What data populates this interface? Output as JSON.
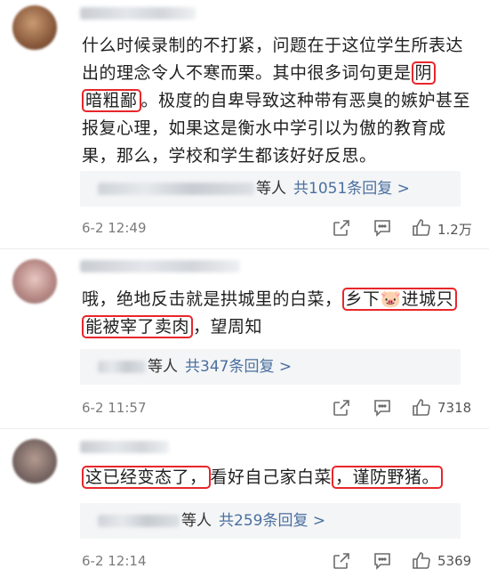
{
  "comments": [
    {
      "text_before": "什么时候录制的不打紧，问题在于这位学生所表达出的理念令人不寒而栗。其中很多词句更是",
      "hl1": "阴",
      "hl2": "暗粗鄙",
      "text_after": "。极度的自卑导致这种带有恶臭的嫉妒甚至报复心理，如果这是衡水中学引以为傲的教育成果，那么，学校和学生都该好好反思。",
      "reply_suffix": "等人",
      "reply_link": "共1051条回复 >",
      "time": "6-2 12:49",
      "likes": "1.2万"
    },
    {
      "text_before": "哦，绝地反击就是拱城里的白菜，",
      "hl1": "乡下🐷进城只",
      "hl2": "能被宰了卖肉",
      "text_after": "，望周知",
      "reply_suffix": "等人",
      "reply_link": "共347条回复 >",
      "time": "6-2 11:57",
      "likes": "7318"
    },
    {
      "hl1": "这已经变态了，",
      "text_mid": "看好自己家白菜",
      "hl2": "，谨防野猪。",
      "reply_suffix": "等人",
      "reply_link": "共259条回复 >",
      "time": "6-2 12:14",
      "likes": "5369"
    }
  ],
  "icons": [
    "share-icon",
    "comment-icon",
    "like-icon"
  ]
}
